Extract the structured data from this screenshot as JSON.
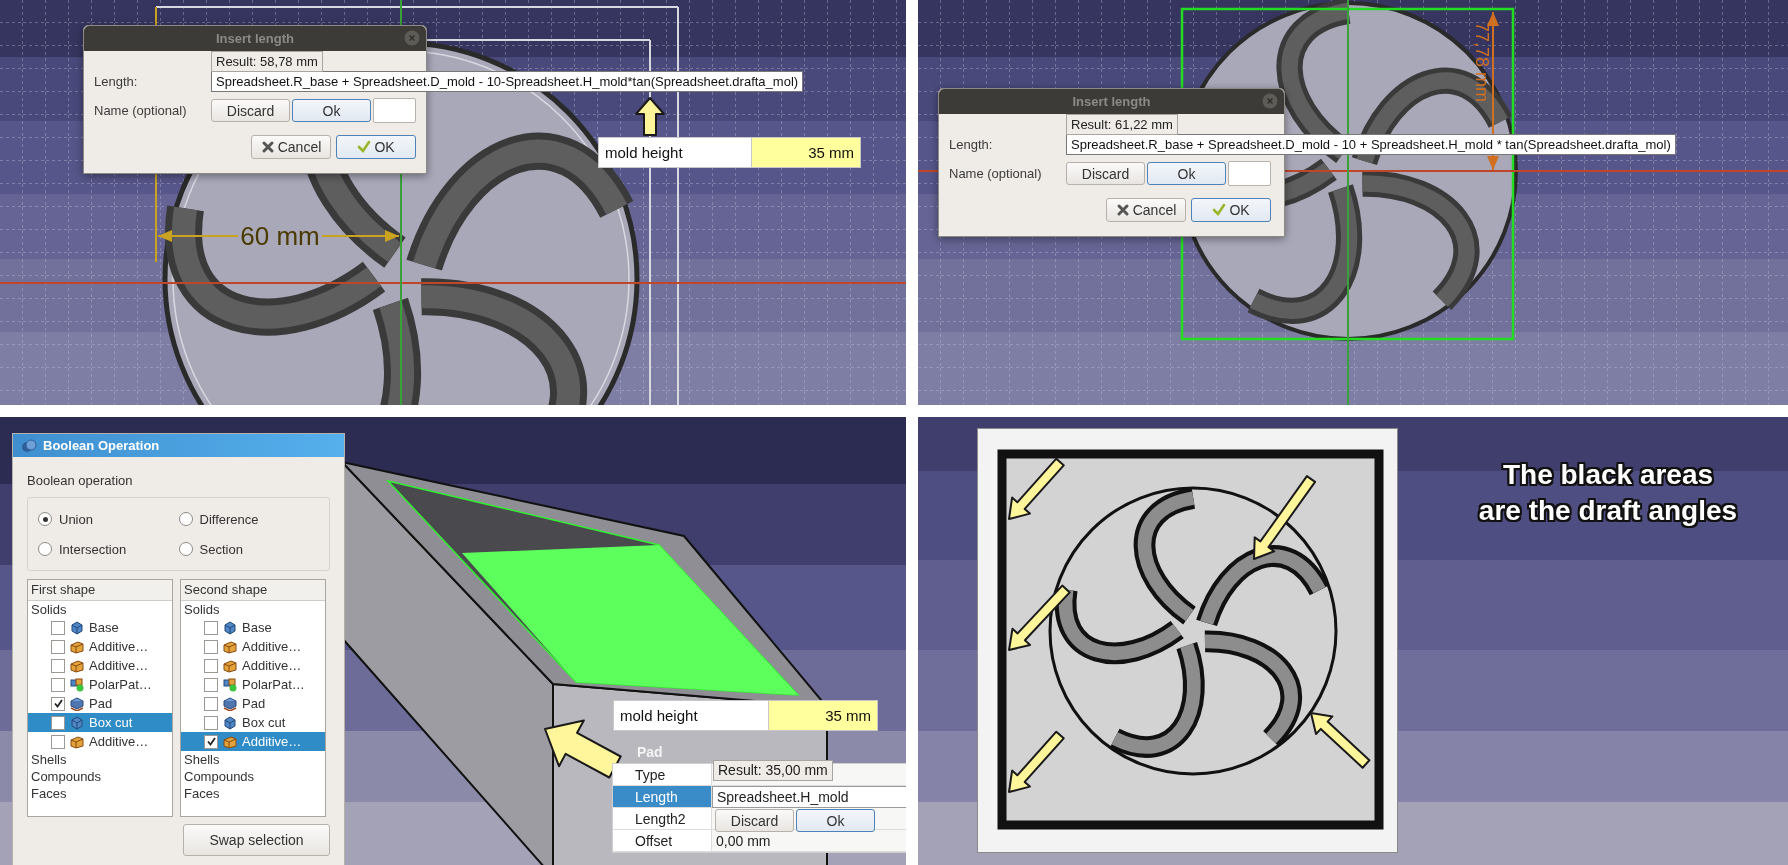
{
  "top_left": {
    "dialog": {
      "title": "Insert length",
      "tooltip": "Result: 58,78 mm",
      "length_label": "Length:",
      "length_value": "Spreadsheet.R_base + Spreadsheet.D_mold - 10-Spreadsheet.H_mold*tan(Spreadsheet.drafta_mol)",
      "name_label": "Name (optional)",
      "editor_buttons": [
        {
          "label": "Discard",
          "default": false
        },
        {
          "label": "Ok",
          "default": true
        }
      ],
      "buttons": [
        {
          "label": "Cancel",
          "kind": "cancel",
          "default": false
        },
        {
          "label": "OK",
          "kind": "ok",
          "default": true
        }
      ]
    },
    "spreadsheet_cell": {
      "label": "mold height",
      "value": "35 mm"
    },
    "dimension": "60 mm"
  },
  "top_right": {
    "dialog": {
      "title": "Insert length",
      "tooltip": "Result: 61,22 mm",
      "length_label": "Length:",
      "length_value": "Spreadsheet.R_base + Spreadsheet.D_mold - 10 + Spreadsheet.H_mold * tan(Spreadsheet.drafta_mol)",
      "name_label": "Name (optional)",
      "editor_buttons": [
        {
          "label": "Discard",
          "default": false
        },
        {
          "label": "Ok",
          "default": true
        }
      ],
      "buttons": [
        {
          "label": "Cancel",
          "kind": "cancel",
          "default": false
        },
        {
          "label": "OK",
          "kind": "ok",
          "default": true
        }
      ]
    },
    "dimension": "77,78 mm"
  },
  "bottom_left": {
    "boolean_dialog": {
      "title": "Boolean Operation",
      "group_label": "Boolean operation",
      "operations": [
        {
          "label": "Union",
          "selected": true
        },
        {
          "label": "Difference",
          "selected": false
        },
        {
          "label": "Intersection",
          "selected": false
        },
        {
          "label": "Section",
          "selected": false
        }
      ],
      "shape_lists": [
        {
          "header": "First shape",
          "groups": [
            {
              "label": "Solids",
              "children": [
                {
                  "label": "Base",
                  "kind": "body",
                  "checked": false,
                  "selected": false
                },
                {
                  "label": "Additive…",
                  "kind": "additive",
                  "checked": false,
                  "selected": false
                },
                {
                  "label": "Additive…",
                  "kind": "additive",
                  "checked": false,
                  "selected": false
                },
                {
                  "label": "PolarPat…",
                  "kind": "pattern",
                  "checked": false,
                  "selected": false
                },
                {
                  "label": "Pad",
                  "kind": "pad",
                  "checked": true,
                  "selected": false
                },
                {
                  "label": "Box cut",
                  "kind": "body",
                  "checked": false,
                  "selected": true
                },
                {
                  "label": "Additive…",
                  "kind": "additive",
                  "checked": false,
                  "selected": false
                }
              ]
            },
            {
              "label": "Shells"
            },
            {
              "label": "Compounds"
            },
            {
              "label": "Faces"
            }
          ]
        },
        {
          "header": "Second shape",
          "groups": [
            {
              "label": "Solids",
              "children": [
                {
                  "label": "Base",
                  "kind": "body",
                  "checked": false,
                  "selected": false
                },
                {
                  "label": "Additive…",
                  "kind": "additive",
                  "checked": false,
                  "selected": false
                },
                {
                  "label": "Additive…",
                  "kind": "additive",
                  "checked": false,
                  "selected": false
                },
                {
                  "label": "PolarPat…",
                  "kind": "pattern",
                  "checked": false,
                  "selected": false
                },
                {
                  "label": "Pad",
                  "kind": "pad",
                  "checked": false,
                  "selected": false
                },
                {
                  "label": "Box cut",
                  "kind": "body",
                  "checked": false,
                  "selected": false
                },
                {
                  "label": "Additive…",
                  "kind": "additive",
                  "checked": true,
                  "selected": true
                }
              ]
            },
            {
              "label": "Shells"
            },
            {
              "label": "Compounds"
            },
            {
              "label": "Faces"
            }
          ]
        }
      ],
      "swap_button": "Swap selection"
    },
    "spreadsheet_cell": {
      "label": "mold height",
      "value": "35 mm"
    },
    "pad_panel": {
      "title": "Pad",
      "tooltip": "Result: 35,00 mm",
      "rows": [
        {
          "name": "Type",
          "selected": false
        },
        {
          "name": "Length",
          "value": "Spreadsheet.H_mold",
          "selected": true
        },
        {
          "name": "Length2",
          "selected": false
        },
        {
          "name": "Offset",
          "value": "0,00 mm",
          "selected": false
        }
      ],
      "editor_buttons": [
        {
          "label": "Discard",
          "default": false
        },
        {
          "label": "Ok",
          "default": true
        }
      ]
    }
  },
  "bottom_right": {
    "caption_lines": [
      "The black areas",
      "are the draft angles"
    ]
  }
}
